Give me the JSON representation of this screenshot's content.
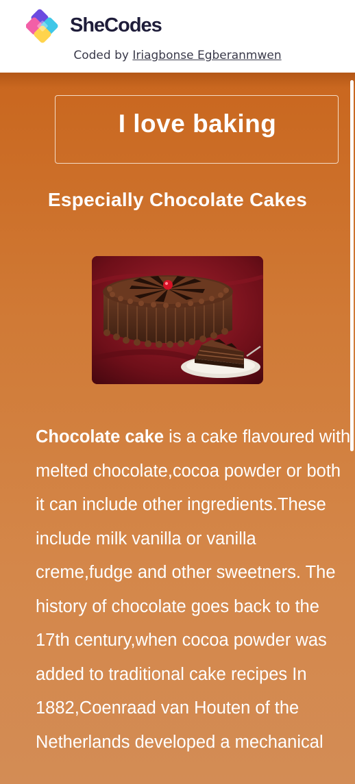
{
  "header": {
    "brand": "SheCodes",
    "byline_prefix": "Coded by ",
    "author_name": "Iriagbonse Egberanmwen"
  },
  "main": {
    "title": "I love baking",
    "subtitle": "Especially Chocolate Cakes",
    "image": {
      "icon": "chocolate-cake-photo"
    },
    "description": {
      "lead": "Chocolate cake",
      "body": " is a cake flavoured with melted chocolate,cocoa powder or both it can include other ingredients.These include milk vanilla or vanilla creme,fudge and other sweetners. The history of chocolate goes back to the 17th century,when cocoa powder was added to traditional cake recipes In 1882,Coenraad van Houten of the Netherlands developed a mechanical"
    }
  },
  "colors": {
    "accent_top": "#c9661e",
    "accent_bottom": "#d38c55",
    "text_light": "#ffffff",
    "brand_dark": "#1f1d3a"
  }
}
